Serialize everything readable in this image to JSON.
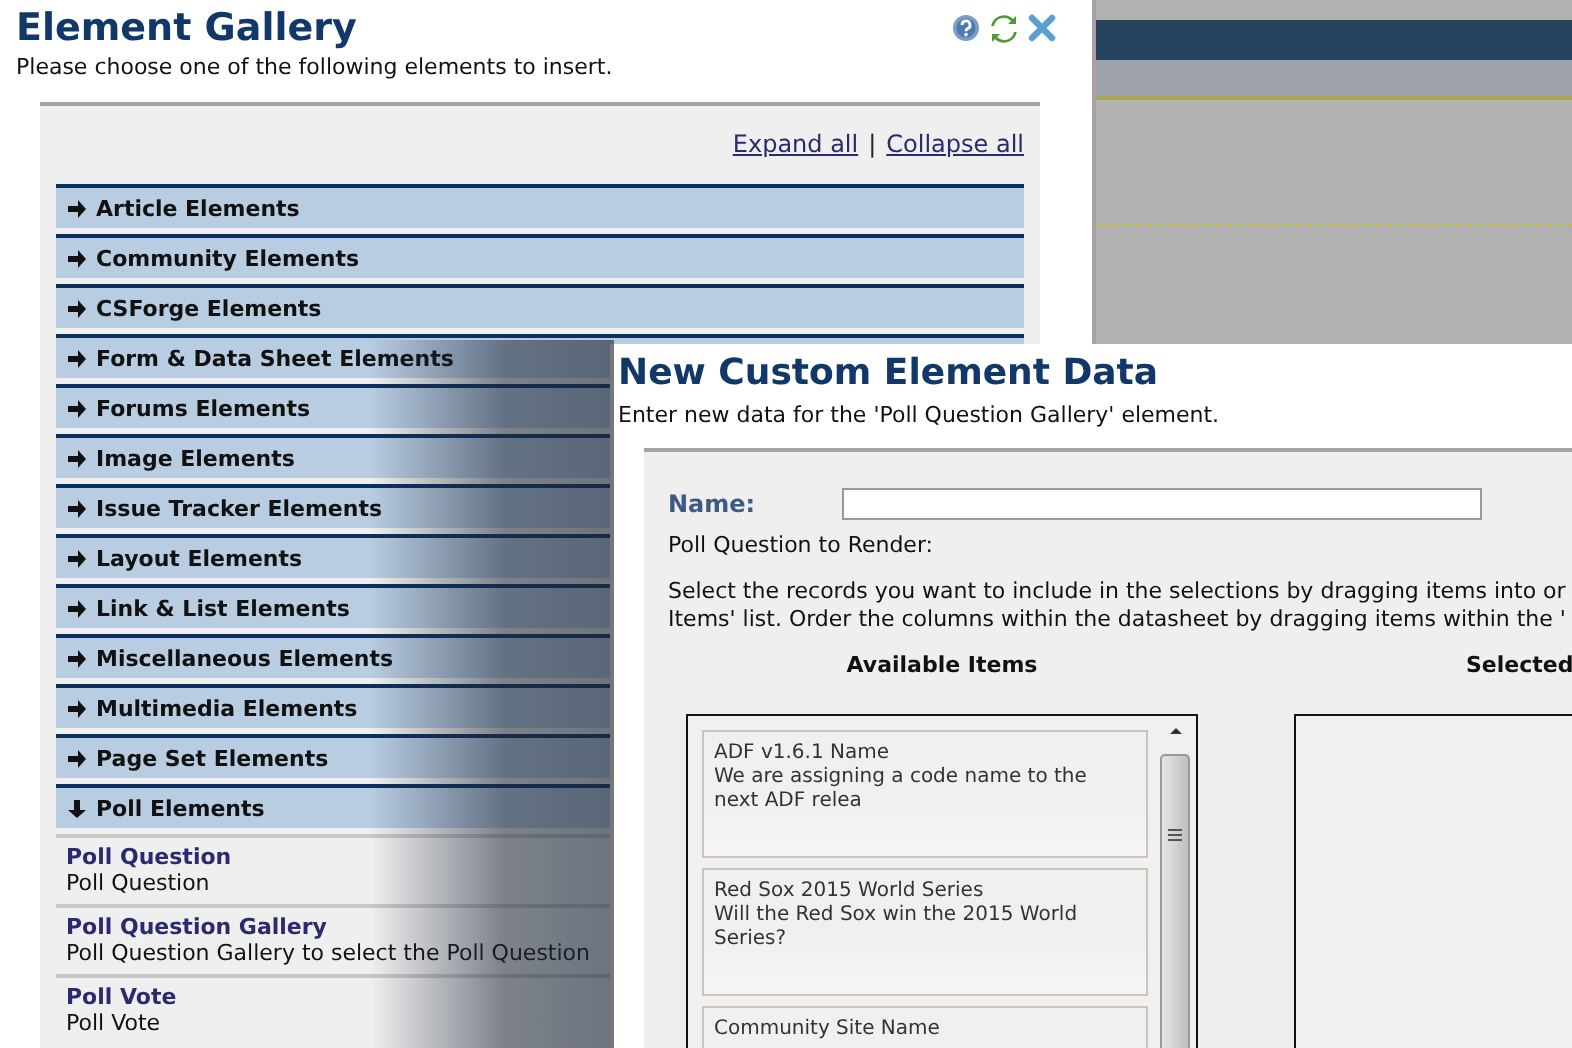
{
  "gallery": {
    "title": "Element Gallery",
    "subtitle": "Please choose one of the following elements to insert.",
    "links": [
      "Expand all",
      "Collapse all"
    ],
    "link_separator": "|",
    "categories": [
      {
        "label": "Article Elements",
        "expanded": false
      },
      {
        "label": "Community Elements",
        "expanded": false
      },
      {
        "label": "CSForge Elements",
        "expanded": false
      },
      {
        "label": "Form & Data Sheet Elements",
        "expanded": false
      },
      {
        "label": "Forums Elements",
        "expanded": false
      },
      {
        "label": "Image Elements",
        "expanded": false
      },
      {
        "label": "Issue Tracker Elements",
        "expanded": false
      },
      {
        "label": "Layout Elements",
        "expanded": false
      },
      {
        "label": "Link & List Elements",
        "expanded": false
      },
      {
        "label": "Miscellaneous Elements",
        "expanded": false
      },
      {
        "label": "Multimedia Elements",
        "expanded": false
      },
      {
        "label": "Page Set Elements",
        "expanded": false
      },
      {
        "label": "Poll Elements",
        "expanded": true,
        "items": [
          {
            "title": "Poll Question",
            "description": "Poll Question"
          },
          {
            "title": "Poll Question Gallery",
            "description": "Poll Question Gallery to select the Poll Question"
          },
          {
            "title": "Poll Vote",
            "description": "Poll Vote"
          }
        ]
      }
    ]
  },
  "dialog": {
    "title": "New Custom Element Data",
    "subtitle": "Enter new data for the 'Poll Question Gallery' element.",
    "name_label": "Name:",
    "render_label": "Poll Question to Render:",
    "instructions": [
      "Select the records you want to include in the selections by dragging items into or",
      "Items' list. Order the columns within the datasheet by dragging items within the '"
    ],
    "available_heading": "Available Items",
    "selected_heading": "Selected",
    "available_items": [
      {
        "title": "ADF v1.6.1 Name",
        "description": "We are assigning a code name to the next ADF relea"
      },
      {
        "title": "Red Sox 2015 World Series",
        "description": "Will the Red Sox win the 2015 World Series?"
      },
      {
        "title": "Community Site Name"
      }
    ]
  }
}
